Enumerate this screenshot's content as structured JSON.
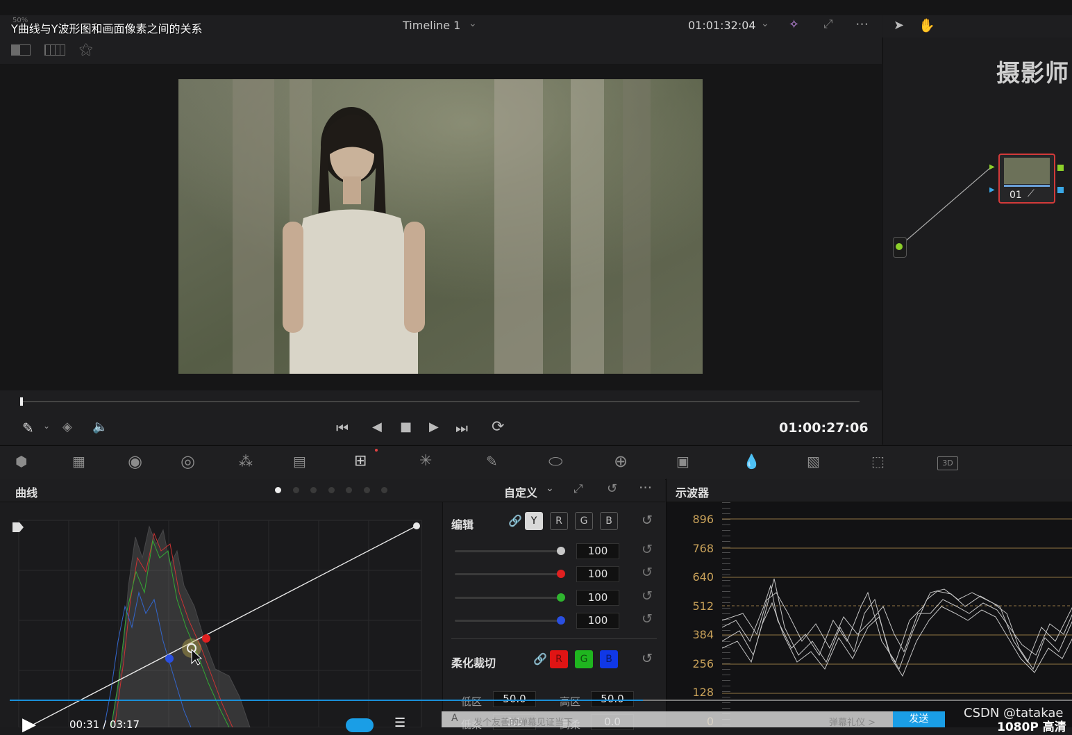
{
  "overlay": {
    "title_caption": "Y曲线与Y波形图和画面像素之间的关系",
    "zoom_value": "50%",
    "watermark": "摄影师",
    "csdn": "CSDN @tatakae",
    "quality": "1080P 高清"
  },
  "viewer_header": {
    "timeline_name": "Timeline 1",
    "timecode": "01:01:32:04"
  },
  "transport": {
    "timecode": "01:00:27:06"
  },
  "node": {
    "label": "01"
  },
  "curves_panel": {
    "title": "曲线",
    "mode": "自定义",
    "page_dots": 7,
    "active_dot": 0
  },
  "edit_panel": {
    "label": "编辑",
    "channels": [
      "Y",
      "R",
      "G",
      "B"
    ],
    "active_channel": "Y",
    "rows": [
      {
        "color": "#c8c8c8",
        "value": "100"
      },
      {
        "color": "#e02020",
        "value": "100"
      },
      {
        "color": "#2fb52f",
        "value": "100"
      },
      {
        "color": "#2a4fe0",
        "value": "100"
      }
    ],
    "soft_clip_label": "柔化裁切",
    "soft_clip_channels": [
      {
        "label": "R",
        "color": "#e01414"
      },
      {
        "label": "G",
        "color": "#1fb51f"
      },
      {
        "label": "B",
        "color": "#1038e6"
      }
    ],
    "low_label": "低区",
    "low_value": "50.0",
    "high_label": "高区",
    "high_value": "50.0",
    "low_soft_label": "低柔",
    "low_soft_value": "0.0",
    "high_soft_label": "高柔",
    "high_soft_value": "0.0"
  },
  "scope_panel": {
    "title": "示波器",
    "ticks": [
      "896",
      "768",
      "640",
      "512",
      "384",
      "256",
      "128",
      "0"
    ]
  },
  "video_player": {
    "time": "00:31 / 03:17",
    "danmaku_hint": "发个友善的弹幕见证当下",
    "danmaku_etiquette": "弹幕礼仪 >",
    "send_label": "发送"
  },
  "colors": {
    "accent_blue": "#1a8fd8",
    "scope_ticks": "#c9a25a",
    "node_border": "#d33a3a"
  }
}
